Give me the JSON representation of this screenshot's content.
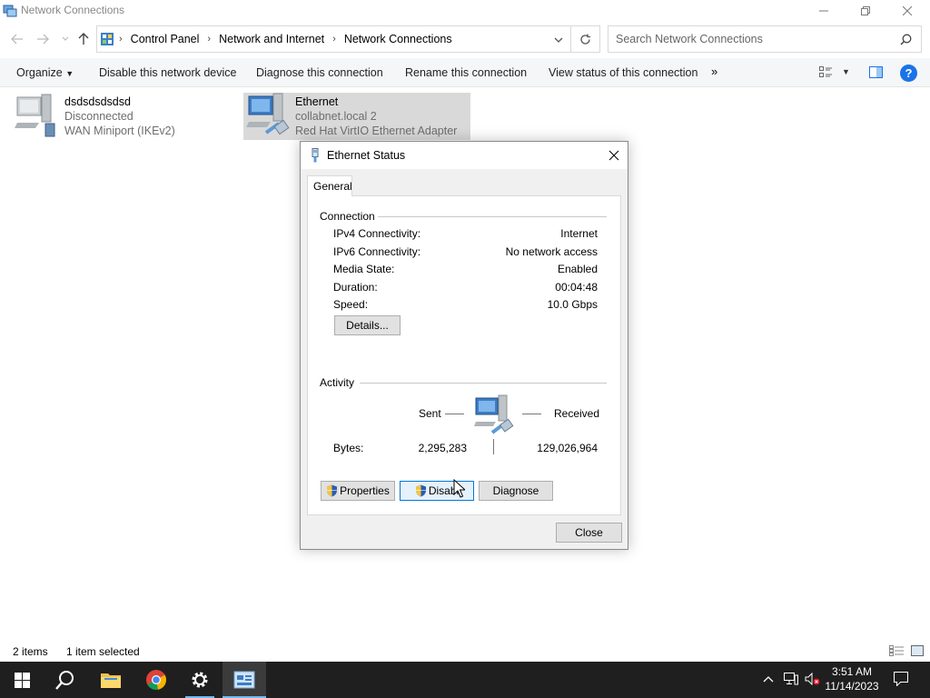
{
  "window": {
    "title": "Network Connections"
  },
  "address": {
    "crumbs": [
      "Control Panel",
      "Network and Internet",
      "Network Connections"
    ],
    "search_placeholder": "Search Network Connections"
  },
  "commands": {
    "organize": "Organize",
    "disable_device": "Disable this network device",
    "diagnose": "Diagnose this connection",
    "rename": "Rename this connection",
    "view_status": "View status of this connection",
    "more": "»",
    "help": "?"
  },
  "connections": [
    {
      "name": "dsdsdsdsdsd",
      "status": "Disconnected",
      "device": "WAN Miniport (IKEv2)"
    },
    {
      "name": "Ethernet",
      "status": "collabnet.local 2",
      "device": "Red Hat VirtIO Ethernet Adapter"
    }
  ],
  "statusbar": {
    "count": "2 items",
    "selected": "1 item selected"
  },
  "dialog": {
    "title": "Ethernet Status",
    "tab": "General",
    "connection_header": "Connection",
    "rows": [
      {
        "label": "IPv4 Connectivity:",
        "value": "Internet"
      },
      {
        "label": "IPv6 Connectivity:",
        "value": "No network access"
      },
      {
        "label": "Media State:",
        "value": "Enabled"
      },
      {
        "label": "Duration:",
        "value": "00:04:48"
      },
      {
        "label": "Speed:",
        "value": "10.0 Gbps"
      }
    ],
    "details_button": "Details...",
    "activity_header": "Activity",
    "sent_label": "Sent",
    "received_label": "Received",
    "bytes_label": "Bytes:",
    "bytes_sent": "2,295,283",
    "bytes_received": "129,026,964",
    "properties_button": "Properties",
    "disable_button": "Disabl",
    "diagnose_button": "Diagnose",
    "close_button": "Close"
  },
  "taskbar": {
    "time": "3:51 AM",
    "date": "11/14/2023"
  },
  "colors": {
    "taskbar": "#1f1f1f",
    "selection": "#d9d9d9",
    "accent": "#0078d7",
    "help": "#1a73e8"
  }
}
